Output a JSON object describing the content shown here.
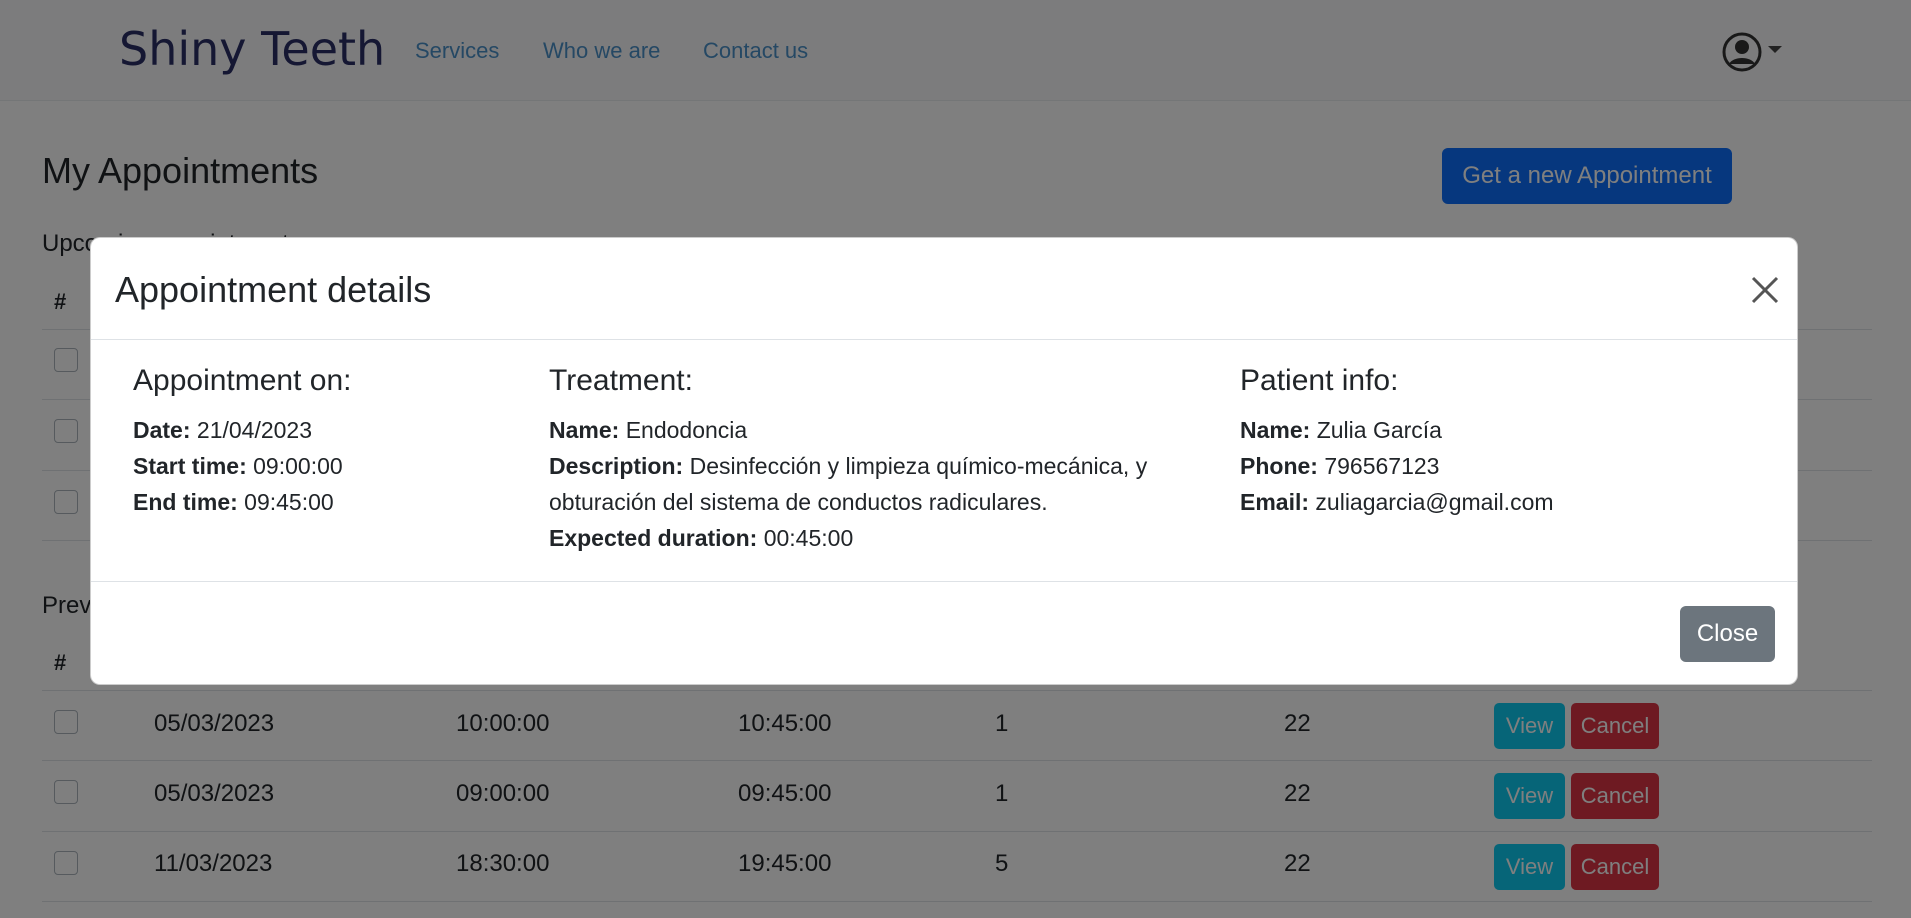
{
  "navbar": {
    "brand": "Shiny Teeth",
    "links": [
      "Services",
      "Who we are",
      "Contact us"
    ]
  },
  "main": {
    "title": "My Appointments",
    "new_button": "Get a new Appointment",
    "upcoming": {
      "title": "Upcoming appointments",
      "hash": "#"
    },
    "previous": {
      "title": "Previous appointments",
      "hash": "#",
      "rows": [
        {
          "date": "05/03/2023",
          "start": "10:00:00",
          "end": "10:45:00",
          "treatment": "1",
          "patient": "22"
        },
        {
          "date": "05/03/2023",
          "start": "09:00:00",
          "end": "09:45:00",
          "treatment": "1",
          "patient": "22"
        },
        {
          "date": "11/03/2023",
          "start": "18:30:00",
          "end": "19:45:00",
          "treatment": "5",
          "patient": "22"
        }
      ],
      "view_label": "View",
      "cancel_label": "Cancel"
    }
  },
  "modal": {
    "title": "Appointment details",
    "close_label": "Close",
    "appointment": {
      "heading": "Appointment on:",
      "date_label": "Date:",
      "date": "21/04/2023",
      "start_label": "Start time:",
      "start": "09:00:00",
      "end_label": "End time:",
      "end": "09:45:00"
    },
    "treatment": {
      "heading": "Treatment:",
      "name_label": "Name:",
      "name": "Endodoncia",
      "desc_label": "Description:",
      "description": "Desinfección y limpieza químico-mecánica, y obturación del sistema de conductos radiculares.",
      "duration_label": "Expected duration:",
      "duration": "00:45:00"
    },
    "patient": {
      "heading": "Patient info:",
      "name_label": "Name:",
      "name": "Zulia García",
      "phone_label": "Phone:",
      "phone": "796567123",
      "email_label": "Email:",
      "email": "zuliagarcia@gmail.com"
    }
  },
  "colors": {
    "primary": "#0d6efd",
    "info": "#0dcaf0",
    "danger": "#dc3545",
    "secondary": "#6c757d",
    "brand": "#2a2f66",
    "nav_link": "#4a90c9"
  },
  "icons": {
    "user": "user-circle-icon",
    "close": "close-icon"
  }
}
